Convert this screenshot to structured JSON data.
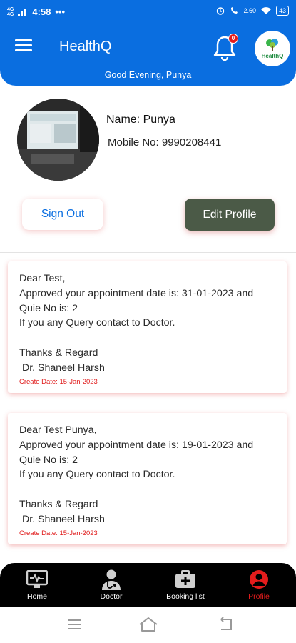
{
  "status_bar": {
    "time": "4:58",
    "net_left": "4G",
    "net_left2": "4G",
    "data_speed": "2.60",
    "data_unit": "KB/S",
    "battery": "43"
  },
  "header": {
    "title": "HealthQ",
    "notification_count": "0",
    "logo_text": "HealthQ",
    "greeting": "Good Evening, Punya"
  },
  "profile": {
    "name": "Name: Punya",
    "mobile": "Mobile No: 9990208441"
  },
  "actions": {
    "sign_out": "Sign Out",
    "edit_profile": "Edit Profile"
  },
  "messages": [
    {
      "greeting": "Dear Test,",
      "line1": "Approved your appointment date is: 31-01-2023 and",
      "line2": "Quie No is: 2",
      "line3": "If you any Query contact to Doctor.",
      "sign1": "Thanks & Regard",
      "sign2": " Dr. Shaneel Harsh",
      "date": "Create Date: 15-Jan-2023"
    },
    {
      "greeting": "Dear Test Punya,",
      "line1": "Approved your appointment date is: 19-01-2023 and",
      "line2": "Quie No is: 2",
      "line3": "If you any Query contact to Doctor.",
      "sign1": "Thanks & Regard",
      "sign2": " Dr. Shaneel Harsh",
      "date": "Create Date: 15-Jan-2023"
    }
  ],
  "bottom_nav": {
    "home": "Home",
    "doctor": "Doctor",
    "booking": "Booking list",
    "profile": "Profile"
  },
  "colors": {
    "primary": "#0a6ee0",
    "edit_button": "#4b5a47",
    "accent_red": "#e41c1c",
    "nav_bg": "#000000"
  }
}
